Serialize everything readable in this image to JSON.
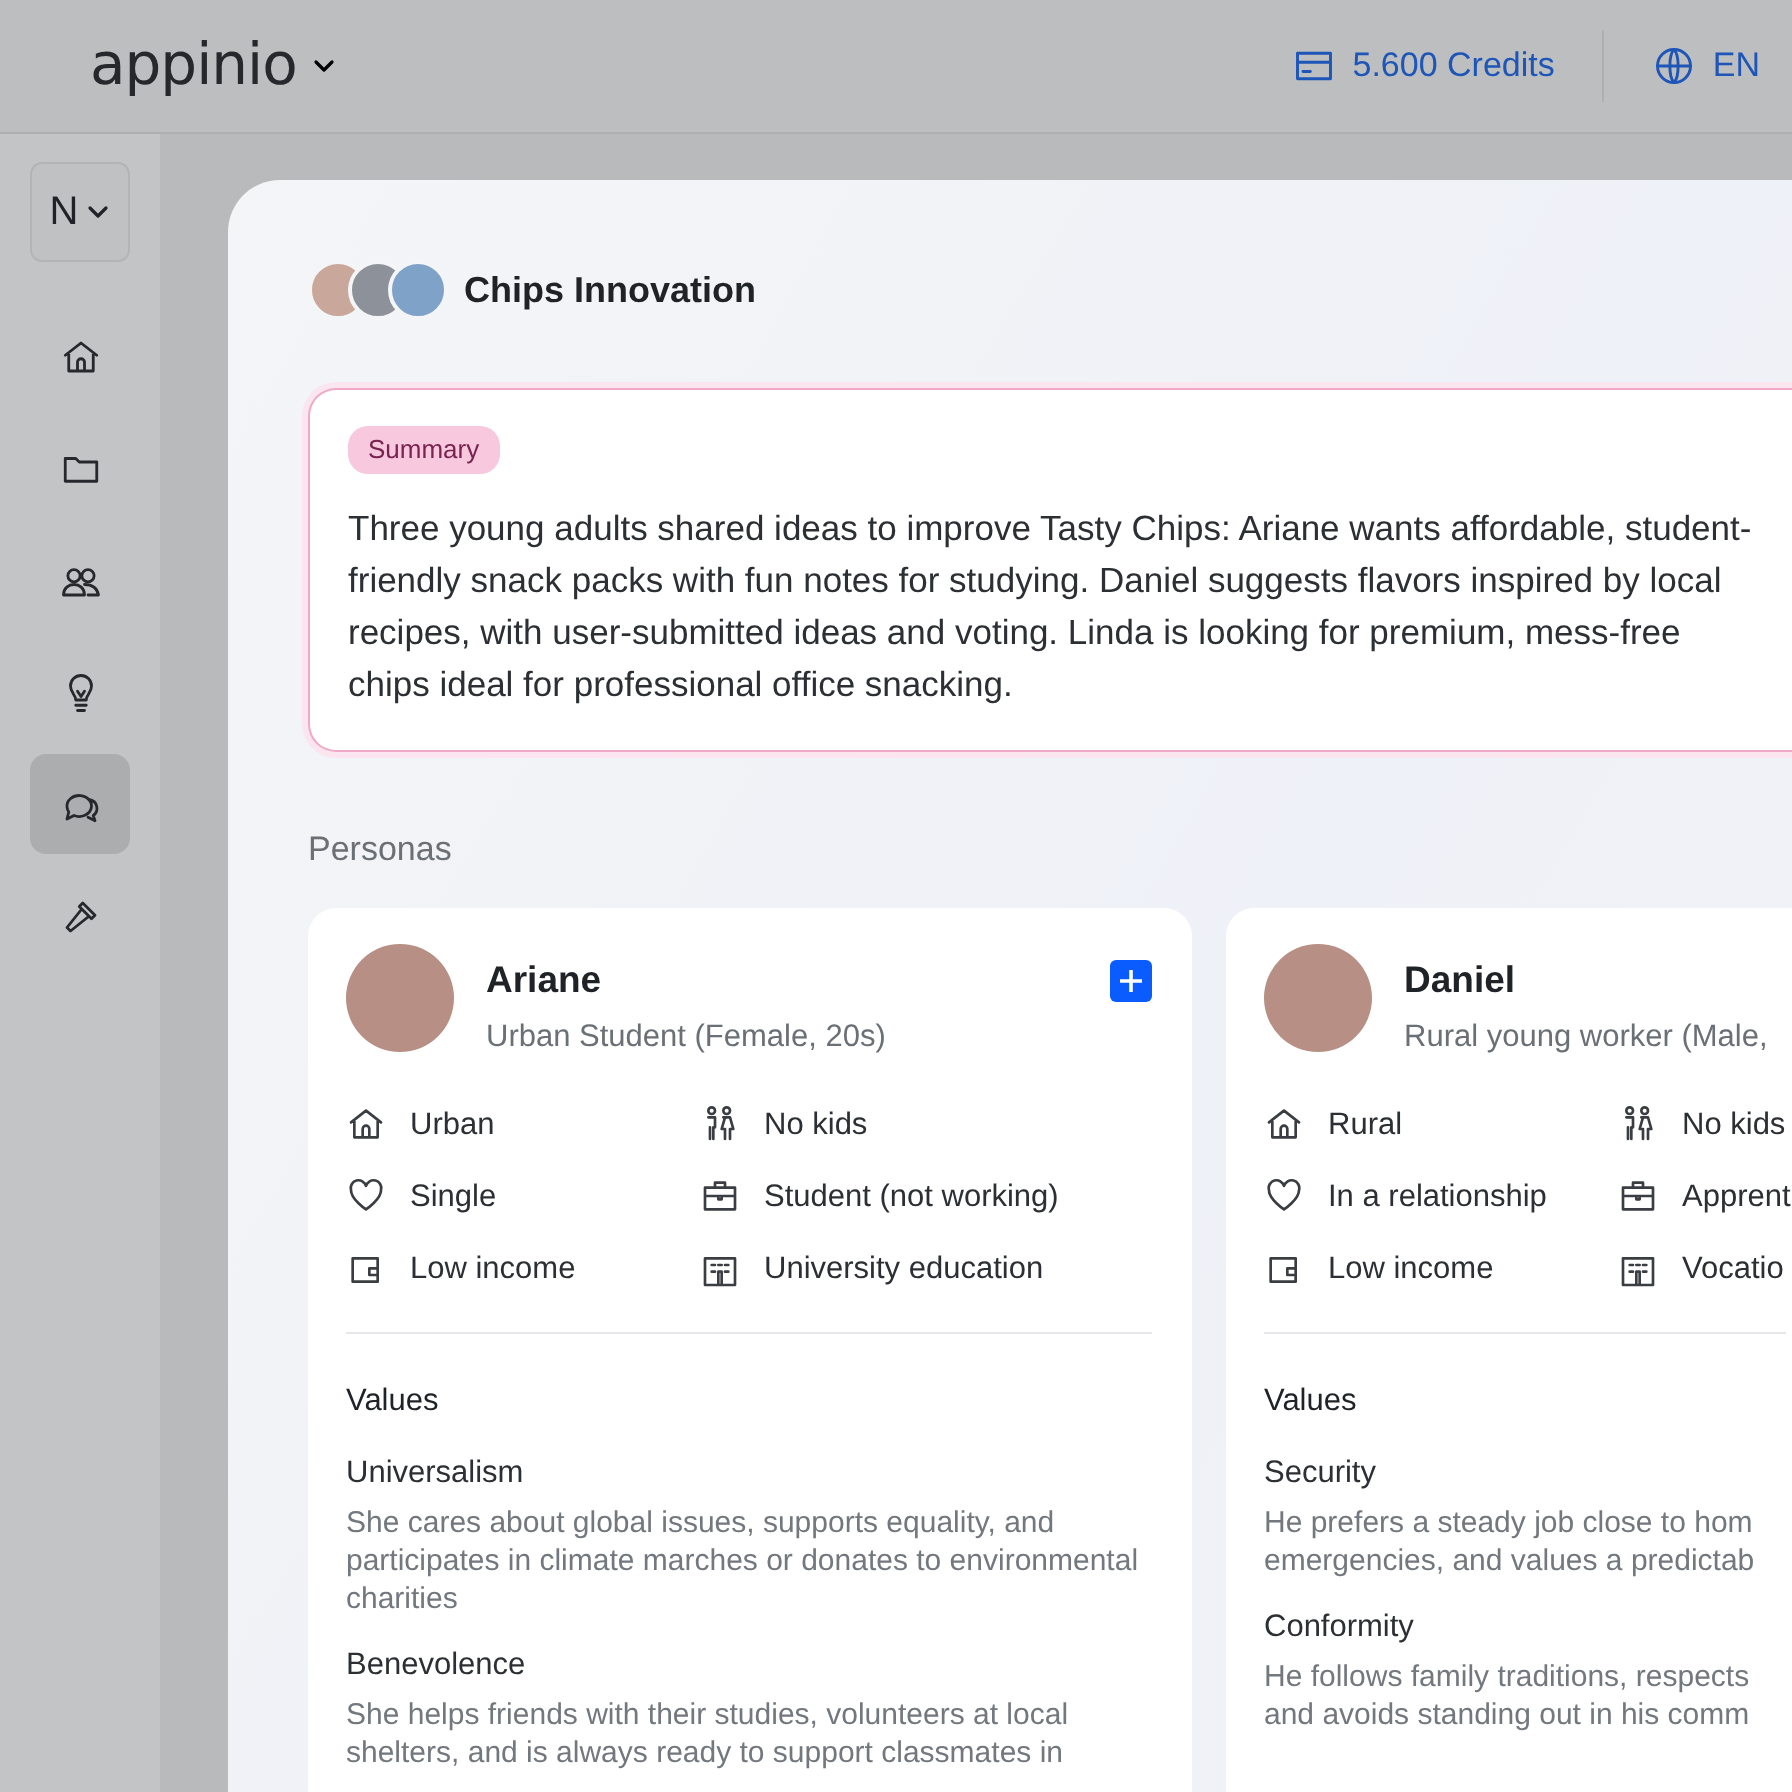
{
  "header": {
    "logo": "appinio",
    "credits": "5.600 Credits",
    "language": "EN"
  },
  "sidebar": {
    "workspace": "N",
    "items": [
      {
        "kind": "home",
        "selected": false
      },
      {
        "kind": "folder",
        "selected": false
      },
      {
        "kind": "users",
        "selected": false
      },
      {
        "kind": "lightbulb",
        "selected": false
      },
      {
        "kind": "chat",
        "selected": true
      },
      {
        "kind": "hammer",
        "selected": false
      }
    ]
  },
  "study": {
    "title": "Chips Innovation"
  },
  "summary": {
    "badge": "Summary",
    "text": "Three young adults shared ideas to improve Tasty Chips: Ariane wants affordable, student-friendly snack packs with fun notes for studying. Daniel suggests flavors inspired by local recipes, with user-submitted ideas and voting. Linda is looking for premium, mess-free chips ideal for professional office snacking."
  },
  "personas_heading": "Personas",
  "personas": [
    {
      "name": "Ariane",
      "description": "Urban Student (Female, 20s)",
      "add_button": true,
      "attributes": [
        {
          "kind": "home",
          "label": "Urban"
        },
        {
          "kind": "family",
          "label": "No kids"
        },
        {
          "kind": "heart",
          "label": "Single"
        },
        {
          "kind": "briefcase",
          "label": "Student (not working)"
        },
        {
          "kind": "wallet",
          "label": "Low income"
        },
        {
          "kind": "building",
          "label": "University education"
        }
      ],
      "values_heading": "Values",
      "values": [
        {
          "title": "Universalism",
          "text": "She cares about global issues, supports equality, and participates in climate marches or donates to environmental charities"
        },
        {
          "title": "Benevolence",
          "text": "She helps friends with their studies, volunteers at local shelters, and is always ready to support classmates in"
        }
      ]
    },
    {
      "name": "Daniel",
      "description": "Rural young worker (Male,",
      "attributes": [
        {
          "kind": "home",
          "label": "Rural"
        },
        {
          "kind": "family",
          "label": "No kids"
        },
        {
          "kind": "heart",
          "label": "In a relationship"
        },
        {
          "kind": "briefcase",
          "label": "Apprent"
        },
        {
          "kind": "wallet",
          "label": "Low income"
        },
        {
          "kind": "building",
          "label": "Vocatio"
        }
      ],
      "values_heading": "Values",
      "values": [
        {
          "title": "Security",
          "text": "He prefers a steady job close to hom\nemergencies, and values a predictab"
        },
        {
          "title": "Conformity",
          "text": "He follows family traditions, respects\nand avoids standing out in his comm"
        }
      ]
    }
  ]
}
